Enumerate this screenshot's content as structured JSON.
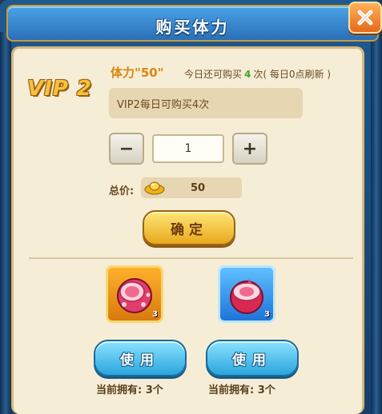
{
  "window": {
    "title": "购买体力"
  },
  "vip": {
    "label": "VIP 2"
  },
  "stamina": {
    "label": "体力\"50\""
  },
  "buy_info": {
    "prefix": "今日还可购买",
    "remaining": "4",
    "suffix": "次( 每日0点刷新 )"
  },
  "limit": {
    "text": "VIP2每日可购买4次"
  },
  "quantity": {
    "minus": "−",
    "plus": "+",
    "value": "1"
  },
  "total": {
    "label": "总价:",
    "value": "50"
  },
  "confirm": {
    "label": "确定"
  },
  "items": [
    {
      "count": "3",
      "use_label": "使用",
      "own_text": "当前拥有: 3个",
      "frame": "gold"
    },
    {
      "count": "3",
      "use_label": "使用",
      "own_text": "当前拥有: 3个",
      "frame": "blue"
    }
  ],
  "icons": [
    "close-icon",
    "gold-ingot-icon",
    "fruit-icon"
  ],
  "colors": {
    "title_blue": "#2a6fb8",
    "parchment": "#f6edd6",
    "gold_button": "#e8a81e",
    "blue_button": "#2aa5de",
    "accent_orange": "#d9870f"
  }
}
